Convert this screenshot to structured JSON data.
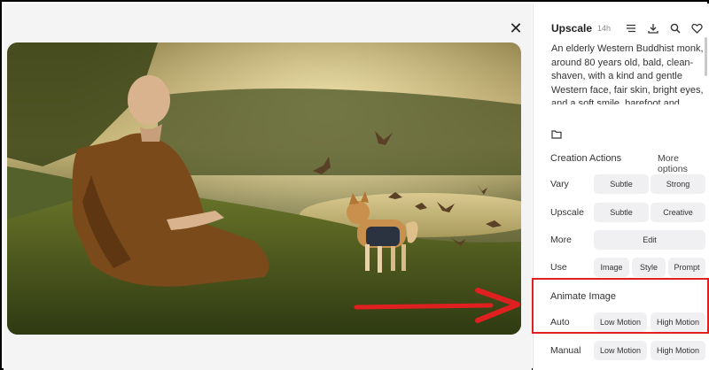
{
  "viewer": {
    "close_icon": "close-icon"
  },
  "header": {
    "job_type": "Upscale",
    "job_time": "14h",
    "icons": [
      "options-icon",
      "download-icon",
      "search-icon",
      "heart-icon"
    ]
  },
  "prompt": {
    "text": "An elderly Western Buddhist monk, around 80 years old, bald, clean-shaven, with a kind and gentle Western face, fair skin, bright eyes, and a soft smile, barefoot and"
  },
  "creation_actions": {
    "title": "Creation Actions",
    "more_label": "More options",
    "rows": [
      {
        "label": "Vary",
        "buttons": [
          "Subtle",
          "Strong"
        ]
      },
      {
        "label": "Upscale",
        "buttons": [
          "Subtle",
          "Creative"
        ]
      },
      {
        "label": "More",
        "buttons": [
          "Edit"
        ]
      },
      {
        "label": "Use",
        "buttons": [
          "Image",
          "Style",
          "Prompt"
        ]
      }
    ]
  },
  "animate": {
    "title": "Animate Image",
    "rows": [
      {
        "label": "Auto",
        "buttons": [
          "Low Motion",
          "High Motion"
        ]
      },
      {
        "label": "Manual",
        "buttons": [
          "Low Motion",
          "High Motion"
        ]
      }
    ]
  },
  "colors": {
    "annotation_red": "#e02020",
    "button_bg": "#f0f0f2"
  }
}
